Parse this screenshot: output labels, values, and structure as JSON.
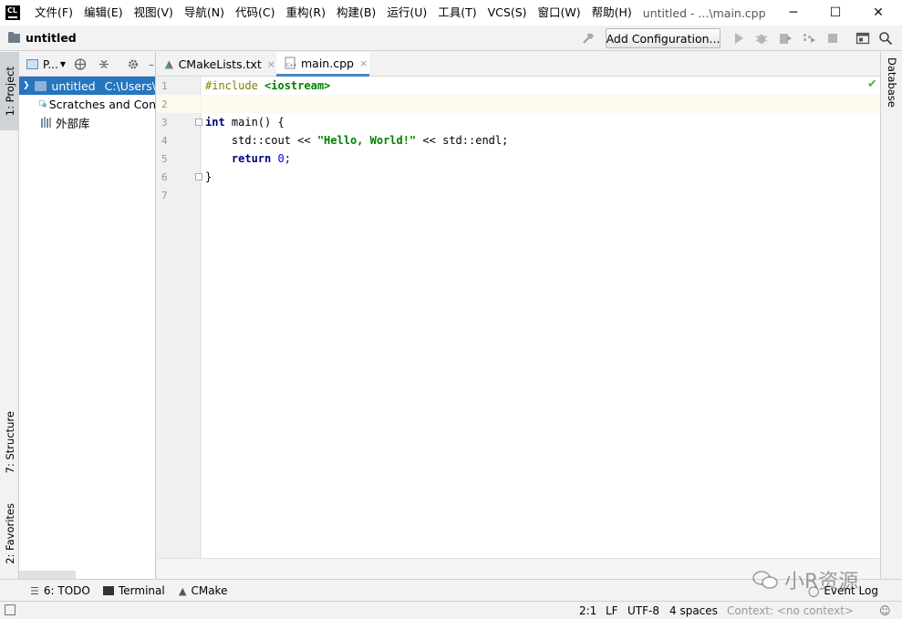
{
  "menu": {
    "items": [
      "文件(F)",
      "编辑(E)",
      "视图(V)",
      "导航(N)",
      "代码(C)",
      "重构(R)",
      "构建(B)",
      "运行(U)",
      "工具(T)",
      "VCS(S)",
      "窗口(W)",
      "帮助(H)"
    ],
    "window_title": "untitled - ...\\main.cpp",
    "minimize": "─",
    "maximize": "☐",
    "close": "✕"
  },
  "navbar": {
    "project_name": "untitled",
    "add_config_label": "Add Configuration..."
  },
  "left_tabs": {
    "project": "1: Project",
    "structure": "7: Structure",
    "favorites": "2: Favorites"
  },
  "project_panel": {
    "view_label": "P...",
    "tree": [
      {
        "label": "untitled",
        "path": "C:\\Users\\"
      },
      {
        "label": "Scratches and Con"
      },
      {
        "label": "外部库"
      }
    ]
  },
  "editor": {
    "tabs": [
      {
        "label": "CMakeLists.txt",
        "close": "×"
      },
      {
        "label": "main.cpp",
        "close": "×"
      }
    ],
    "line_numbers": [
      "1",
      "2",
      "3",
      "4",
      "5",
      "6",
      "7"
    ],
    "code": {
      "l1_directive": "#include",
      "l1_header": "<iostream>",
      "l3_kw": "int",
      "l3_rest": " main() {",
      "l4_a": "    std::cout << ",
      "l4_str": "\"Hello, World!\"",
      "l4_b": " << std::endl;",
      "l5_kw": "return",
      "l5_num": "0",
      "l5_end": ";",
      "l6": "}"
    },
    "check_mark": "✔"
  },
  "right_tabs": {
    "database": "Database"
  },
  "bottom_tools": {
    "todo": "6: TODO",
    "terminal": "Terminal",
    "cmake": "CMake",
    "event_log": "Event Log"
  },
  "watermark": "小R资源",
  "status": {
    "position": "2:1",
    "line_sep": "LF",
    "encoding": "UTF-8",
    "indent": "4 spaces",
    "context": "Context: <no context>"
  },
  "colors": {
    "selection": "#2675bf",
    "tab_underline": "#4a88c7",
    "keyword": "#000080",
    "string": "#008000",
    "number": "#0000ff",
    "preprocessor": "#808000"
  },
  "icons": [
    "app-logo-icon",
    "folder-icon",
    "hammer-icon",
    "run-icon",
    "debug-icon",
    "coverage-icon",
    "profile-icon",
    "stop-icon",
    "project-structure-icon",
    "search-icon",
    "globe-icon",
    "collapse-icon",
    "gear-icon",
    "cmake-icon",
    "cpp-file-icon",
    "check-icon",
    "event-log-icon",
    "inspector-icon"
  ]
}
